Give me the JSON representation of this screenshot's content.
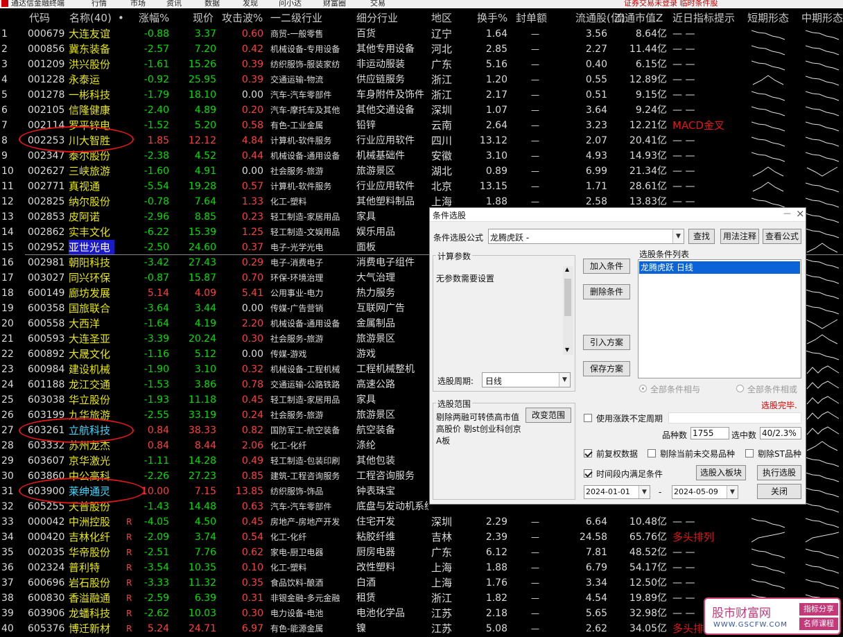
{
  "menubar": {
    "app_title": "通达信金融终端",
    "items": [
      "行情",
      "市场",
      "资讯",
      "数据",
      "发现",
      "问小达",
      "财富圈",
      "交易"
    ],
    "status": "证券交易未登录  临时条件股"
  },
  "columns": [
    "代码",
    "名称(40)",
    "•",
    "涨幅%",
    "现价",
    "攻击波%",
    "一二级行业",
    "细分行业",
    "地区",
    "换手%",
    "封单额",
    "流通股(亿)",
    "流通市值Z",
    "近日指标提示",
    "短期形态",
    "中期形态"
  ],
  "colors": {
    "up": "#ff4040",
    "down": "#00e000",
    "flat": "#dcdcdc",
    "highlight": "#40d8ff",
    "selected_bg": "#1a1ac8",
    "annot": "#e01818"
  },
  "rows": [
    {
      "n": "1",
      "code": "000679",
      "name": "大连友谊",
      "r": "",
      "chg": "-0.88",
      "price": "3.37",
      "atk": "0.60",
      "ind": "商贸-一般零售",
      "sub": "百货",
      "reg": "辽宁",
      "turn": "1.64",
      "seal": "—",
      "fl": "3.56",
      "mcap": "8.64亿",
      "tip": "— —",
      "s": "d",
      "m": "d"
    },
    {
      "n": "2",
      "code": "000856",
      "name": "冀东装备",
      "r": "",
      "chg": "-2.57",
      "price": "7.20",
      "atk": "0.42",
      "ind": "机械设备-专用设备",
      "sub": "其他专用设备",
      "reg": "河北",
      "turn": "2.85",
      "seal": "—",
      "fl": "2.27",
      "mcap": "11.44亿",
      "tip": "— —",
      "s": "d",
      "m": "d"
    },
    {
      "n": "3",
      "code": "001209",
      "name": "洪兴股份",
      "r": "",
      "chg": "-1.61",
      "price": "15.26",
      "atk": "0.39",
      "ind": "纺织服饰-服装家纺",
      "sub": "非运动服装",
      "reg": "广东",
      "turn": "5.16",
      "seal": "—",
      "fl": "0.40",
      "mcap": "6.15亿",
      "tip": "— —",
      "s": "d",
      "m": "d"
    },
    {
      "n": "4",
      "code": "001228",
      "name": "永泰运",
      "r": "",
      "chg": "-0.92",
      "price": "25.95",
      "atk": "0.39",
      "ind": "交通运输-物流",
      "sub": "供应链服务",
      "reg": "浙江",
      "turn": "1.20",
      "seal": "—",
      "fl": "0.55",
      "mcap": "12.89亿",
      "tip": "— —",
      "s": "a",
      "m": "d"
    },
    {
      "n": "5",
      "code": "001278",
      "name": "一彬科技",
      "r": "",
      "chg": "-1.79",
      "price": "18.10",
      "atk": "0.00",
      "ind": "汽车-汽车零部件",
      "sub": "车身附件及饰件",
      "reg": "浙江",
      "turn": "2.17",
      "seal": "—",
      "fl": "0.51",
      "mcap": "9.15亿",
      "tip": "— —",
      "s": "d",
      "m": "d"
    },
    {
      "n": "6",
      "code": "002105",
      "name": "信隆健康",
      "r": "",
      "chg": "-2.40",
      "price": "4.89",
      "atk": "0.20",
      "ind": "汽车-摩托车及其他",
      "sub": "其他交通设备",
      "reg": "深圳",
      "turn": "1.07",
      "seal": "—",
      "fl": "3.64",
      "mcap": "9.24亿",
      "tip": "— —",
      "s": "d",
      "m": "d"
    },
    {
      "n": "7",
      "code": "002114",
      "name": "罗平锌电",
      "r": "",
      "chg": "-1.52",
      "price": "5.20",
      "atk": "0.58",
      "ind": "有色-工业金属",
      "sub": "铅锌",
      "reg": "云南",
      "turn": "2.64",
      "seal": "—",
      "fl": "3.23",
      "mcap": "12.21亿",
      "tip": "MACD金叉",
      "s": "d",
      "m": "d"
    },
    {
      "n": "8",
      "code": "002253",
      "name": "川大智胜",
      "r": "",
      "chg": "1.85",
      "price": "12.12",
      "atk": "4.84",
      "ind": "计算机-软件服务",
      "sub": "行业应用软件",
      "reg": "四川",
      "turn": "13.12",
      "seal": "—",
      "fl": "2.07",
      "mcap": "20.41亿",
      "tip": "— —",
      "s": "d",
      "m": "d"
    },
    {
      "n": "9",
      "code": "002347",
      "name": "泰尔股份",
      "r": "",
      "chg": "-2.38",
      "price": "4.52",
      "atk": "0.44",
      "ind": "机械设备-通用设备",
      "sub": "机械基础件",
      "reg": "安徽",
      "turn": "3.10",
      "seal": "—",
      "fl": "4.93",
      "mcap": "14.93亿",
      "tip": "— —",
      "s": "d",
      "m": "d"
    },
    {
      "n": "10",
      "code": "002627",
      "name": "三峡旅游",
      "r": "",
      "chg": "-1.60",
      "price": "4.91",
      "atk": "0.00",
      "ind": "社会服务-旅游",
      "sub": "旅游景区",
      "reg": "湖北",
      "turn": "0.89",
      "seal": "—",
      "fl": "6.99",
      "mcap": "21.34亿",
      "tip": "— —",
      "s": "a",
      "m": "v"
    },
    {
      "n": "11",
      "code": "002771",
      "name": "真视通",
      "r": "",
      "chg": "-5.54",
      "price": "19.28",
      "atk": "0.57",
      "ind": "计算机-软件服务",
      "sub": "行业应用软件",
      "reg": "北京",
      "turn": "13.15",
      "seal": "—",
      "fl": "1.71",
      "mcap": "28.61亿",
      "tip": "— —",
      "s": "a",
      "m": "d"
    },
    {
      "n": "12",
      "code": "002825",
      "name": "纳尔股份",
      "r": "",
      "chg": "-0.78",
      "price": "7.64",
      "atk": "1.33",
      "ind": "化工-塑料",
      "sub": "其他塑料制品",
      "reg": "上海",
      "turn": "1.88",
      "seal": "—",
      "fl": "2.58",
      "mcap": "13.83亿",
      "tip": "— —",
      "s": "d",
      "m": "d"
    },
    {
      "n": "13",
      "code": "002853",
      "name": "皮阿诺",
      "r": "",
      "chg": "-2.96",
      "price": "8.85",
      "atk": "0.23",
      "ind": "轻工制造-家居用品",
      "sub": "家具",
      "reg": "广东",
      "turn": "",
      "seal": "",
      "fl": "",
      "mcap": "",
      "tip": "",
      "s": "",
      "m": "d"
    },
    {
      "n": "14",
      "code": "002862",
      "name": "实丰文化",
      "r": "",
      "chg": "-6.22",
      "price": "15.39",
      "atk": "1.25",
      "ind": "轻工制造-文娱用品",
      "sub": "娱乐用品",
      "reg": "",
      "turn": "",
      "seal": "",
      "fl": "",
      "mcap": "",
      "tip": "",
      "s": "",
      "m": "d"
    },
    {
      "n": "15",
      "code": "002952",
      "name": "亚世光电",
      "r": "",
      "chg": "-2.50",
      "price": "24.60",
      "atk": "0.37",
      "ind": "电子-光学光电",
      "sub": "面板",
      "reg": "",
      "turn": "",
      "seal": "",
      "fl": "",
      "mcap": "",
      "tip": "",
      "s": "",
      "m": "a"
    },
    {
      "n": "16",
      "code": "002981",
      "name": "朝阳科技",
      "r": "",
      "chg": "-3.42",
      "price": "27.43",
      "atk": "0.29",
      "ind": "电子-消费电子",
      "sub": "消费电子组件",
      "reg": "",
      "turn": "",
      "seal": "",
      "fl": "",
      "mcap": "",
      "tip": "",
      "s": "",
      "m": "d"
    },
    {
      "n": "17",
      "code": "003027",
      "name": "同兴环保",
      "r": "",
      "chg": "-0.87",
      "price": "15.87",
      "atk": "0.70",
      "ind": "环保-环境治理",
      "sub": "大气治理",
      "reg": "",
      "turn": "",
      "seal": "",
      "fl": "",
      "mcap": "",
      "tip": "",
      "s": "",
      "m": "d"
    },
    {
      "n": "18",
      "code": "600149",
      "name": "廊坊发展",
      "r": "",
      "chg": "5.14",
      "price": "4.09",
      "atk": "5.41",
      "ind": "公用事业-电力",
      "sub": "热力服务",
      "reg": "",
      "turn": "",
      "seal": "",
      "fl": "",
      "mcap": "",
      "tip": "",
      "s": "",
      "m": "d"
    },
    {
      "n": "19",
      "code": "600358",
      "name": "国旅联合",
      "r": "",
      "chg": "-3.64",
      "price": "3.44",
      "atk": "0.00",
      "ind": "传媒-广告营销",
      "sub": "互联网广告",
      "reg": "",
      "turn": "",
      "seal": "",
      "fl": "",
      "mcap": "",
      "tip": "",
      "s": "",
      "m": "d"
    },
    {
      "n": "20",
      "code": "600558",
      "name": "大西洋",
      "r": "",
      "chg": "-1.64",
      "price": "4.19",
      "atk": "2.20",
      "ind": "机械设备-通用设备",
      "sub": "金属制品",
      "reg": "",
      "turn": "",
      "seal": "",
      "fl": "",
      "mcap": "",
      "tip": "",
      "s": "",
      "m": "v"
    },
    {
      "n": "21",
      "code": "600593",
      "name": "大连圣亚",
      "r": "",
      "chg": "-3.39",
      "price": "20.24",
      "atk": "0.30",
      "ind": "社会服务-旅游",
      "sub": "旅游景区",
      "reg": "",
      "turn": "",
      "seal": "",
      "fl": "",
      "mcap": "",
      "tip": "",
      "s": "",
      "m": "a"
    },
    {
      "n": "22",
      "code": "600892",
      "name": "大晟文化",
      "r": "",
      "chg": "-1.16",
      "price": "5.12",
      "atk": "0.00",
      "ind": "传媒-游戏",
      "sub": "游戏",
      "reg": "",
      "turn": "",
      "seal": "",
      "fl": "",
      "mcap": "",
      "tip": "",
      "s": "",
      "m": "d"
    },
    {
      "n": "23",
      "code": "600984",
      "name": "建设机械",
      "r": "",
      "chg": "-1.90",
      "price": "3.10",
      "atk": "0.32",
      "ind": "机械设备-工程机械",
      "sub": "工程机械整机",
      "reg": "",
      "turn": "",
      "seal": "",
      "fl": "",
      "mcap": "",
      "tip": "",
      "s": "",
      "m": "w"
    },
    {
      "n": "24",
      "code": "601188",
      "name": "龙江交通",
      "r": "",
      "chg": "-1.53",
      "price": "3.86",
      "atk": "0.78",
      "ind": "交通运输-公路铁路",
      "sub": "高速公路",
      "reg": "",
      "turn": "",
      "seal": "",
      "fl": "",
      "mcap": "",
      "tip": "",
      "s": "",
      "m": "w"
    },
    {
      "n": "25",
      "code": "603038",
      "name": "华立股份",
      "r": "",
      "chg": "-1.93",
      "price": "11.18",
      "atk": "0.45",
      "ind": "轻工制造-家居用品",
      "sub": "家具",
      "reg": "",
      "turn": "",
      "seal": "",
      "fl": "",
      "mcap": "",
      "tip": "",
      "s": "",
      "m": "w"
    },
    {
      "n": "26",
      "code": "603199",
      "name": "九华旅游",
      "r": "",
      "chg": "-2.55",
      "price": "33.19",
      "atk": "0.24",
      "ind": "社会服务-旅游",
      "sub": "旅游景区",
      "reg": "",
      "turn": "",
      "seal": "",
      "fl": "",
      "mcap": "",
      "tip": "",
      "s": "",
      "m": "w"
    },
    {
      "n": "27",
      "code": "603261",
      "name": "立航科技",
      "r": "",
      "chg": "0.84",
      "price": "38.33",
      "atk": "0.82",
      "ind": "国防军工-航空装备",
      "sub": "航空装备",
      "reg": "",
      "turn": "",
      "seal": "",
      "fl": "",
      "mcap": "",
      "tip": "",
      "s": "",
      "m": "w"
    },
    {
      "n": "28",
      "code": "603332",
      "name": "苏州龙杰",
      "r": "",
      "chg": "0.84",
      "price": "8.44",
      "atk": "2.06",
      "ind": "化工-化纤",
      "sub": "涤纶",
      "reg": "",
      "turn": "",
      "seal": "",
      "fl": "",
      "mcap": "",
      "tip": "",
      "s": "",
      "m": "a"
    },
    {
      "n": "29",
      "code": "603607",
      "name": "京华激光",
      "r": "",
      "chg": "-1.11",
      "price": "14.28",
      "atk": "0.49",
      "ind": "轻工制造-包装印刷",
      "sub": "其他包装",
      "reg": "",
      "turn": "",
      "seal": "",
      "fl": "",
      "mcap": "",
      "tip": "",
      "s": "",
      "m": "d"
    },
    {
      "n": "30",
      "code": "603860",
      "name": "中公高科",
      "r": "",
      "chg": "-2.26",
      "price": "27.23",
      "atk": "0.85",
      "ind": "建筑-工程咨询服务",
      "sub": "工程咨询服务",
      "reg": "",
      "turn": "",
      "seal": "",
      "fl": "",
      "mcap": "",
      "tip": "",
      "s": "",
      "m": "d"
    },
    {
      "n": "31",
      "code": "603900",
      "name": "莱绅通灵",
      "r": "",
      "chg": "10.00",
      "price": "7.15",
      "atk": "13.85",
      "ind": "纺织服饰-饰品",
      "sub": "钟表珠宝",
      "reg": "",
      "turn": "",
      "seal": "",
      "fl": "",
      "mcap": "",
      "tip": "",
      "s": "",
      "m": "d"
    },
    {
      "n": "32",
      "code": "605255",
      "name": "天普股份",
      "r": "",
      "chg": "-1.43",
      "price": "14.48",
      "atk": "0.63",
      "ind": "汽车-汽车零部件",
      "sub": "底盘与发动机系统",
      "reg": "",
      "turn": "",
      "seal": "",
      "fl": "",
      "mcap": "",
      "tip": "",
      "s": "",
      "m": "d"
    },
    {
      "n": "33",
      "code": "000042",
      "name": "中洲控股",
      "r": "R",
      "chg": "-4.05",
      "price": "4.50",
      "atk": "0.45",
      "ind": "房地产-房地产开发",
      "sub": "住宅开发",
      "reg": "深圳",
      "turn": "2.29",
      "seal": "—",
      "fl": "6.64",
      "mcap": "10.48亿",
      "tip": "— —",
      "s": "d",
      "m": "d"
    },
    {
      "n": "34",
      "code": "000420",
      "name": "吉林化纤",
      "r": "R",
      "chg": "-2.09",
      "price": "3.74",
      "atk": "0.54",
      "ind": "化工-化纤",
      "sub": "粘胶纤维",
      "reg": "吉林",
      "turn": "2.39",
      "seal": "—",
      "fl": "24.58",
      "mcap": "65.76亿",
      "tip": "多头排列",
      "s": "u",
      "m": "u"
    },
    {
      "n": "35",
      "code": "002035",
      "name": "华帝股份",
      "r": "R",
      "chg": "-2.51",
      "price": "7.76",
      "atk": "0.62",
      "ind": "家电-厨卫电器",
      "sub": "厨房电器",
      "reg": "广东",
      "turn": "6.12",
      "seal": "—",
      "fl": "7.81",
      "mcap": "48.52亿",
      "tip": "— —",
      "s": "d",
      "m": "d"
    },
    {
      "n": "36",
      "code": "002324",
      "name": "普利特",
      "r": "R",
      "chg": "-3.54",
      "price": "10.35",
      "atk": "0.10",
      "ind": "化工-塑料",
      "sub": "改性塑料",
      "reg": "上海",
      "turn": "1.88",
      "seal": "—",
      "fl": "6.79",
      "mcap": "54.17亿",
      "tip": "— —",
      "s": "d",
      "m": "d"
    },
    {
      "n": "37",
      "code": "600696",
      "name": "岩石股份",
      "r": "R",
      "chg": "-3.33",
      "price": "11.32",
      "atk": "0.35",
      "ind": "食品饮料-酿酒",
      "sub": "白酒",
      "reg": "上海",
      "turn": "1.76",
      "seal": "—",
      "fl": "3.34",
      "mcap": "12.50亿",
      "tip": "— —",
      "s": "d",
      "m": "d"
    },
    {
      "n": "38",
      "code": "600830",
      "name": "香溢融通",
      "r": "R",
      "chg": "-2.59",
      "price": "6.39",
      "atk": "0.31",
      "ind": "非银金融-多元金融",
      "sub": "租赁",
      "reg": "浙江",
      "turn": "1.82",
      "seal": "—",
      "fl": "4.54",
      "mcap": "19.89亿",
      "tip": "— —",
      "s": "d",
      "m": "d"
    },
    {
      "n": "39",
      "code": "603906",
      "name": "龙蟠科技",
      "r": "R",
      "chg": "-2.62",
      "price": "10.03",
      "atk": "0.30",
      "ind": "电力设备-电池",
      "sub": "电池化学品",
      "reg": "江苏",
      "turn": "2.18",
      "seal": "—",
      "fl": "5.65",
      "mcap": "32.98亿",
      "tip": "— —",
      "s": "d",
      "m": "d"
    },
    {
      "n": "40",
      "code": "605376",
      "name": "博迁新材",
      "r": "R",
      "chg": "5.24",
      "price": "24.71",
      "atk": "6.97",
      "ind": "有色-能源金属",
      "sub": "镍",
      "reg": "江苏",
      "turn": "5.08",
      "seal": "—",
      "fl": "2.62",
      "mcap": "34.05亿",
      "tip": "多头排",
      "s": "d",
      "m": ""
    }
  ],
  "dialog": {
    "title": "条件选股",
    "close": "×",
    "minimize": "—",
    "formula_label": "条件选股公式",
    "formula_value": "龙腾虎跃  -",
    "btn_find": "查找",
    "btn_usage": "用法注释",
    "btn_view": "查看公式",
    "calc_params_label": "计算参数",
    "calc_params_text": "无参数需要设置",
    "btn_add": "加入条件",
    "btn_delete": "删除条件",
    "btn_import": "引入方案",
    "btn_save": "保存方案",
    "cond_list_label": "选股条件列表",
    "cond_list": [
      "龙腾虎跃  日线"
    ],
    "period_label": "选股周期:",
    "period_value": "日线",
    "radio_and": "全部条件相与",
    "radio_or": "全部条件相或",
    "done_text": "选股完毕.",
    "scope_label": "选股范围",
    "scope_text": "剔除两融可转债高市值 高股价 剔st创业科创京 A板",
    "btn_change_scope": "改变范围",
    "chk_unfixed": "使用涨跌不定周期",
    "count_label": "品种数",
    "count_value": "1755",
    "selected_label": "选中数",
    "selected_value": "40/2.3%",
    "chk_restore": "前复权数据",
    "chk_exclude_nontrade": "剔除当前未交易品种",
    "chk_exclude_st": "剔除ST品种",
    "chk_period": "时间段内满足条件",
    "btn_to_block": "选股入板块",
    "btn_execute": "执行选股",
    "date_start": "2024-01-01",
    "date_sep": "-",
    "date_end": "2024-05-09",
    "btn_close": "关闭"
  },
  "watermark": {
    "title": "股市财富网",
    "url": "WWW.GSCFW.COM",
    "tag1": "指标分享",
    "tag2": "名师课程"
  }
}
